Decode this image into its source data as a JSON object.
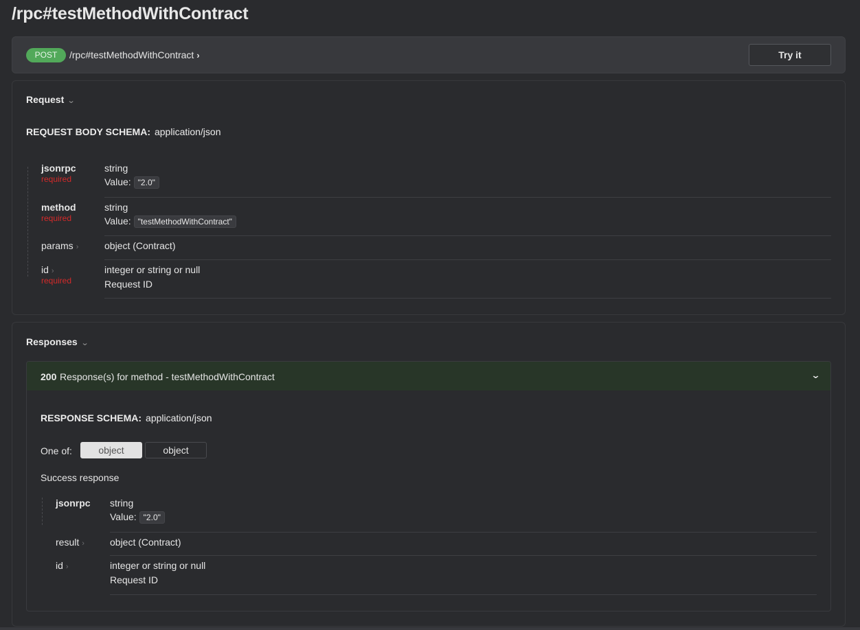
{
  "page_title": "/rpc#testMethodWithContract",
  "endpoint": {
    "method": "POST",
    "path": "/rpc#testMethodWithContract",
    "try_label": "Try it"
  },
  "request": {
    "heading": "Request",
    "schema_label": "REQUEST BODY SCHEMA:",
    "schema_type": "application/json",
    "fields": [
      {
        "name": "jsonrpc",
        "required": "required",
        "type": "string",
        "value_label": "Value:",
        "value": "\"2.0\""
      },
      {
        "name": "method",
        "required": "required",
        "type": "string",
        "value_label": "Value:",
        "value": "\"testMethodWithContract\""
      },
      {
        "name": "params",
        "type": "object (Contract)"
      },
      {
        "name": "id",
        "required": "required",
        "type": "integer or string or null",
        "description": "Request ID"
      }
    ]
  },
  "responses": {
    "heading": "Responses",
    "code": "200",
    "description": "Response(s) for method - testMethodWithContract",
    "schema_label": "RESPONSE SCHEMA:",
    "schema_type": "application/json",
    "one_of_label": "One of:",
    "one_of_options": [
      "object",
      "object"
    ],
    "success_text": "Success response",
    "fields": [
      {
        "name": "jsonrpc",
        "type": "string",
        "value_label": "Value:",
        "value": "\"2.0\""
      },
      {
        "name": "result",
        "type": "object (Contract)"
      },
      {
        "name": "id",
        "type": "integer or string or null",
        "description": "Request ID"
      }
    ]
  },
  "icons": {
    "chevron_right": "chevron-right-icon",
    "chevron_down": "chevron-down-icon"
  },
  "colors": {
    "post_badge": "#52a95a",
    "required": "#d42a2a",
    "response_header": "#283628",
    "background": "#2a2b2e"
  }
}
